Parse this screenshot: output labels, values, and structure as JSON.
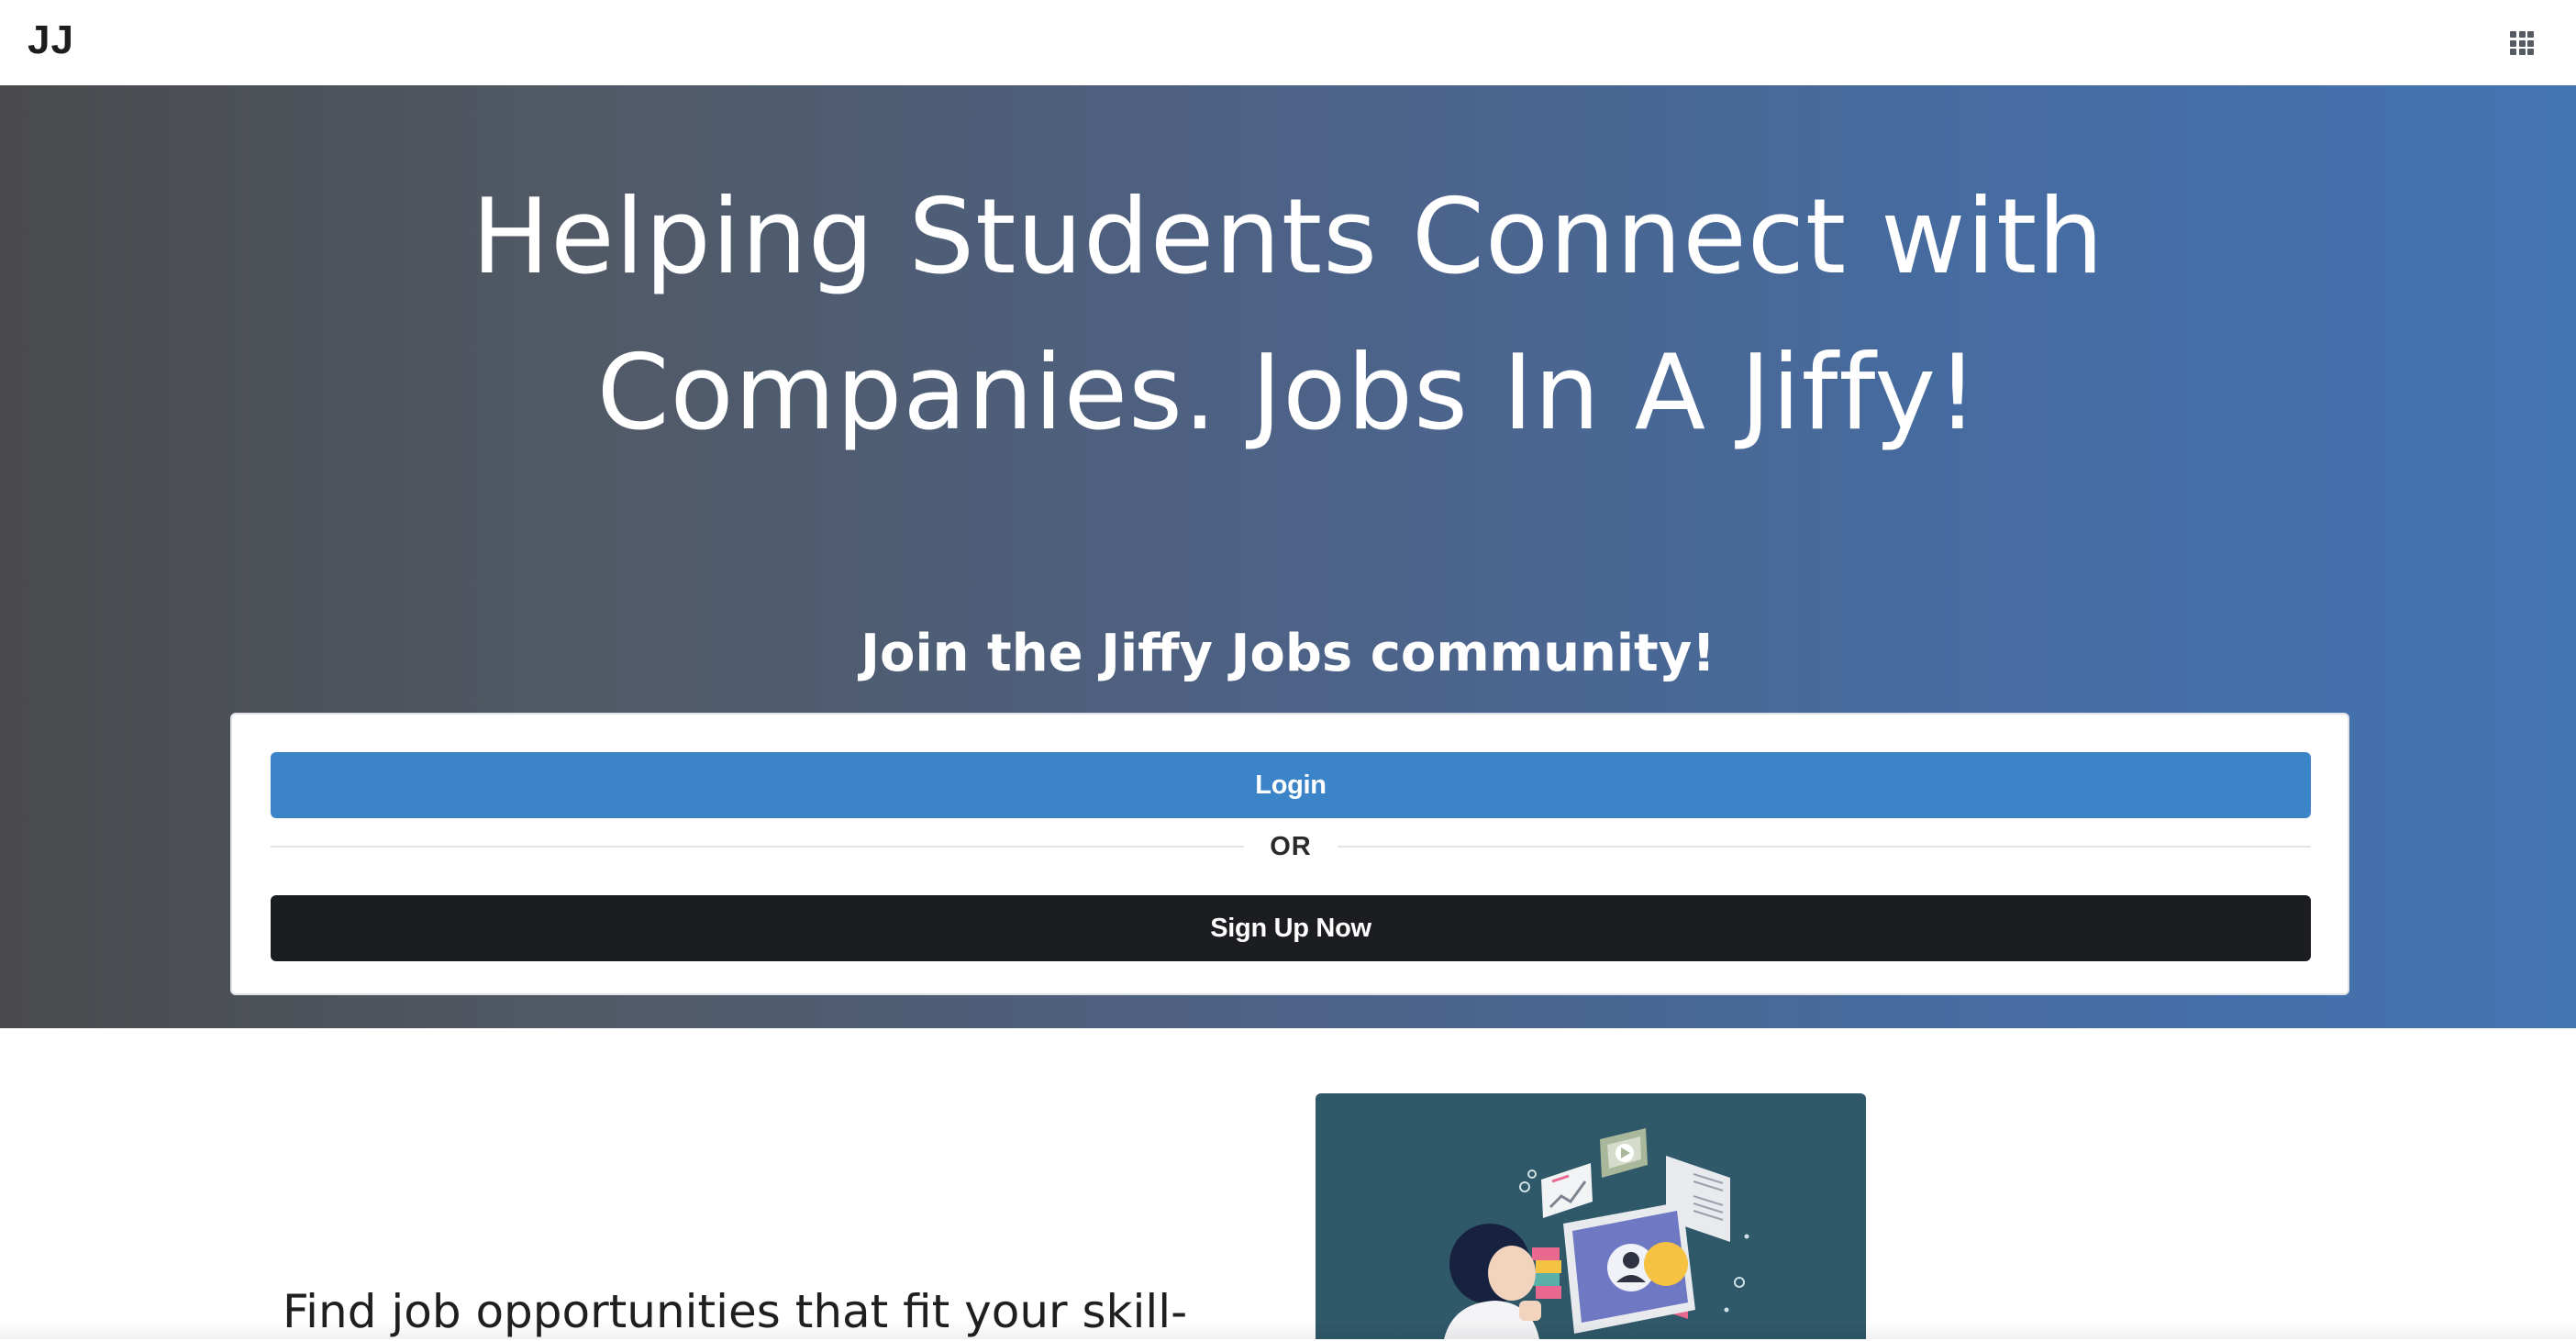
{
  "navbar": {
    "brand": "JJ",
    "apps_icon": "grid-menu-icon"
  },
  "hero": {
    "title_line1": "Helping Students Connect with",
    "title_line2": "Companies. Jobs In A Jiffy!",
    "subtitle": "Join the Jiffy Jobs community!",
    "login_label": "Login",
    "divider_label": "OR",
    "signup_label": "Sign Up Now"
  },
  "feature": {
    "text": "Find job opportunities that fit your skill-",
    "illustration": "student-at-computer-illustration"
  },
  "colors": {
    "hero_gradient_start": "#4a4a4d",
    "hero_gradient_end": "#4374b2",
    "login_button": "#3b84c8",
    "signup_button": "#1c1d20",
    "illustration_bg": "#2f5868"
  }
}
